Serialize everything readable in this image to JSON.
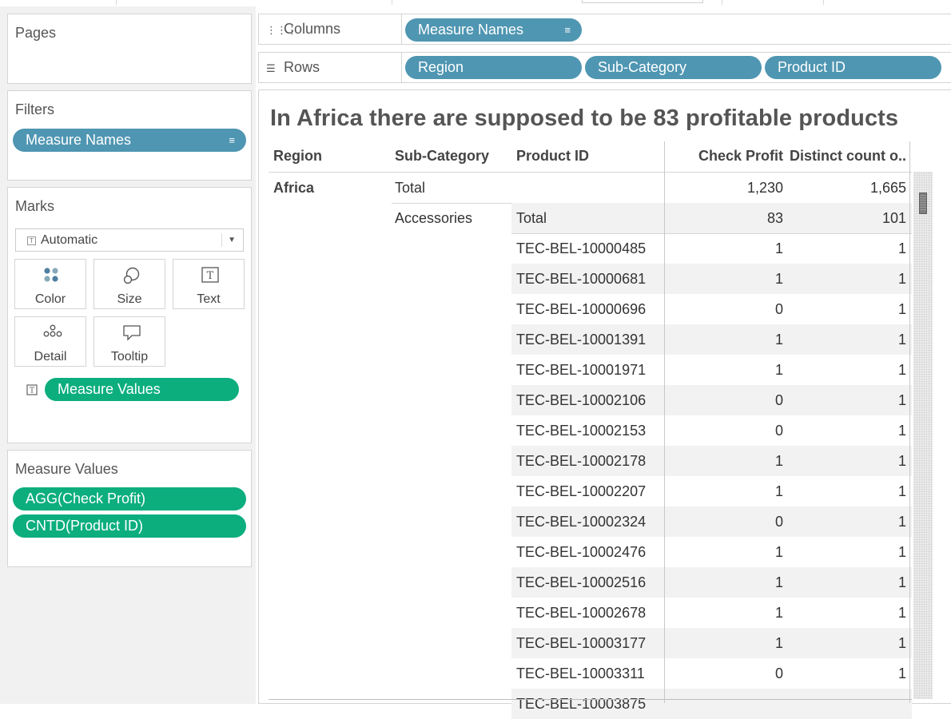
{
  "pages_card": {
    "title": "Pages"
  },
  "filters_card": {
    "title": "Filters",
    "pill": "Measure Names"
  },
  "marks_card": {
    "title": "Marks",
    "mark_type": "Automatic",
    "buttons": {
      "color": "Color",
      "size": "Size",
      "text": "Text",
      "detail": "Detail",
      "tooltip": "Tooltip"
    },
    "text_pill": "Measure Values"
  },
  "measure_values_card": {
    "title": "Measure Values",
    "pills": [
      "AGG(Check Profit)",
      "CNTD(Product ID)"
    ]
  },
  "columns_shelf": {
    "label": "Columns",
    "pills": [
      "Measure Names"
    ]
  },
  "rows_shelf": {
    "label": "Rows",
    "pills": [
      "Region",
      "Sub-Category",
      "Product ID"
    ]
  },
  "view": {
    "title": "In Africa there are supposed to be 83 profitable products",
    "headers": {
      "region": "Region",
      "sub_category": "Sub-Category",
      "product_id": "Product ID",
      "check_profit": "Check Profit",
      "distinct_count": "Distinct count o.."
    },
    "region": "Africa",
    "region_total": {
      "label": "Total",
      "check_profit": "1,230",
      "distinct_count": "1,665"
    },
    "sub_category": "Accessories",
    "sub_total": {
      "label": "Total",
      "check_profit": "83",
      "distinct_count": "101"
    },
    "rows": [
      {
        "product_id": "TEC-BEL-10000485",
        "check_profit": "1",
        "distinct_count": "1"
      },
      {
        "product_id": "TEC-BEL-10000681",
        "check_profit": "1",
        "distinct_count": "1"
      },
      {
        "product_id": "TEC-BEL-10000696",
        "check_profit": "0",
        "distinct_count": "1"
      },
      {
        "product_id": "TEC-BEL-10001391",
        "check_profit": "1",
        "distinct_count": "1"
      },
      {
        "product_id": "TEC-BEL-10001971",
        "check_profit": "1",
        "distinct_count": "1"
      },
      {
        "product_id": "TEC-BEL-10002106",
        "check_profit": "0",
        "distinct_count": "1"
      },
      {
        "product_id": "TEC-BEL-10002153",
        "check_profit": "0",
        "distinct_count": "1"
      },
      {
        "product_id": "TEC-BEL-10002178",
        "check_profit": "1",
        "distinct_count": "1"
      },
      {
        "product_id": "TEC-BEL-10002207",
        "check_profit": "1",
        "distinct_count": "1"
      },
      {
        "product_id": "TEC-BEL-10002324",
        "check_profit": "0",
        "distinct_count": "1"
      },
      {
        "product_id": "TEC-BEL-10002476",
        "check_profit": "1",
        "distinct_count": "1"
      },
      {
        "product_id": "TEC-BEL-10002516",
        "check_profit": "1",
        "distinct_count": "1"
      },
      {
        "product_id": "TEC-BEL-10002678",
        "check_profit": "1",
        "distinct_count": "1"
      },
      {
        "product_id": "TEC-BEL-10003177",
        "check_profit": "1",
        "distinct_count": "1"
      },
      {
        "product_id": "TEC-BEL-10003311",
        "check_profit": "0",
        "distinct_count": "1"
      },
      {
        "product_id": "TEC-BEL-10003875",
        "check_profit": "",
        "distinct_count": ""
      }
    ]
  },
  "colors": {
    "dimension_pill": "#4f96b2",
    "measure_pill": "#0cae7e",
    "band": "#f2f2f2",
    "panel_bg": "#f1f1f1"
  }
}
